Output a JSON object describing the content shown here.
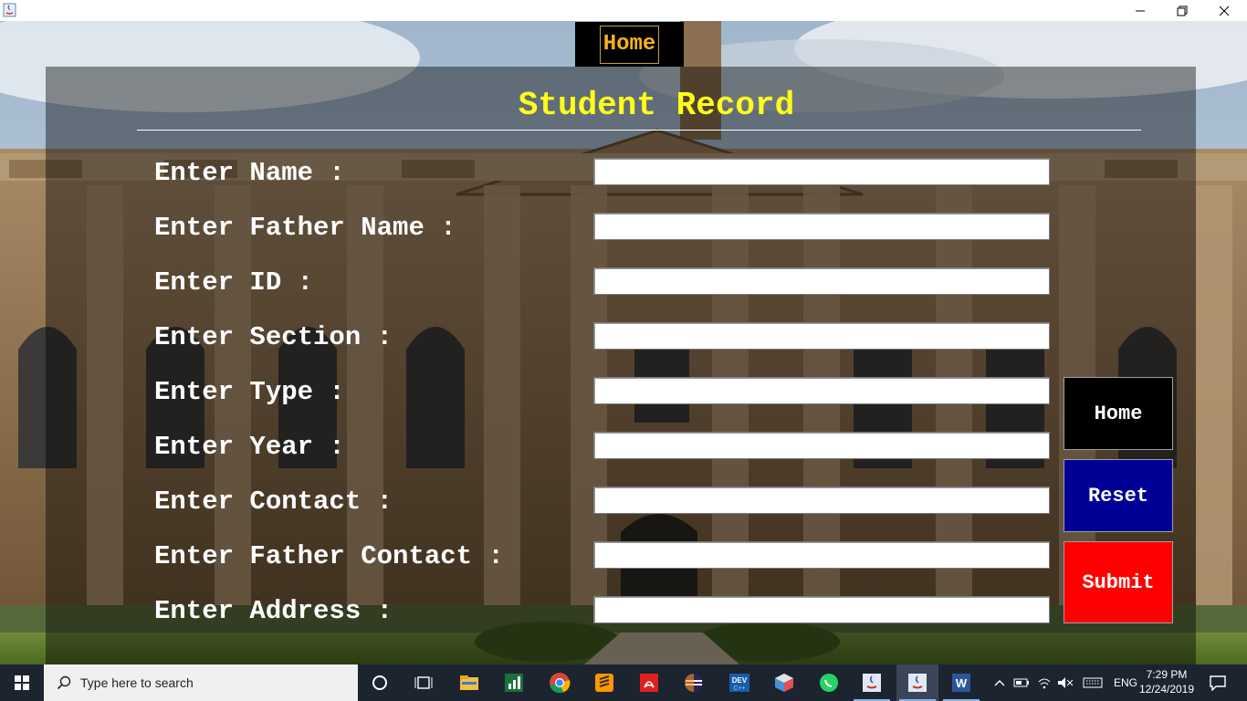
{
  "window": {
    "minimize_symbol": "—",
    "maximize_symbol": "❐",
    "close_symbol": "✕"
  },
  "top_tab": {
    "label": "Home"
  },
  "form": {
    "title": "Student Record",
    "fields": [
      {
        "label": "Enter Name :",
        "value": ""
      },
      {
        "label": "Enter Father Name :",
        "value": ""
      },
      {
        "label": "Enter ID :",
        "value": ""
      },
      {
        "label": "Enter Section :",
        "value": ""
      },
      {
        "label": "Enter Type :",
        "value": ""
      },
      {
        "label": "Enter Year :",
        "value": ""
      },
      {
        "label": "Enter Contact :",
        "value": ""
      },
      {
        "label": "Enter Father Contact :",
        "value": ""
      },
      {
        "label": "Enter Address :",
        "value": ""
      }
    ],
    "buttons": {
      "home": "Home",
      "reset": "Reset",
      "submit": "Submit"
    },
    "colors": {
      "title": "#ffff1a",
      "home_button": "#000000",
      "reset_button": "#000096",
      "submit_button": "#ff0000",
      "top_tab_text": "#f6b21b"
    }
  },
  "taskbar": {
    "search_placeholder": "Type here to search",
    "language": "ENG",
    "time": "7:29 PM",
    "date": "12/24/2019",
    "apps": [
      "cortana-icon",
      "task-view-icon",
      "file-explorer-icon",
      "excel-chart-icon",
      "chrome-icon",
      "sublime-icon",
      "acrobat-icon",
      "eclipse-icon",
      "devcpp-icon",
      "cube-app-icon",
      "whatsapp-icon",
      "java-icon",
      "java-icon",
      "word-icon"
    ]
  }
}
